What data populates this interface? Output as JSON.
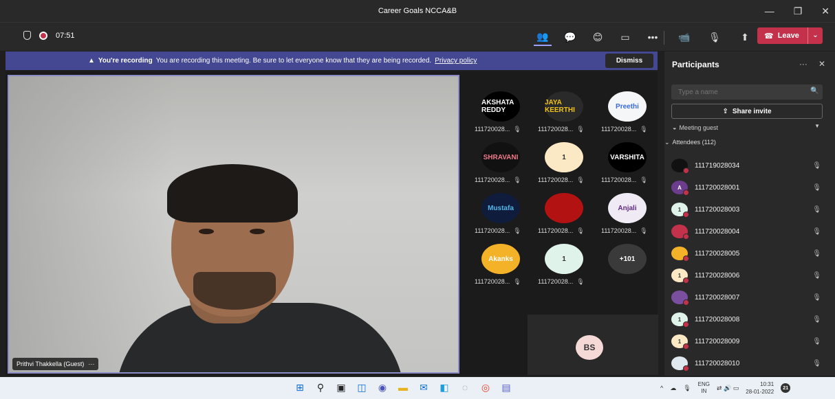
{
  "window": {
    "title": "Career Goals NCCA&B",
    "minimize": "—",
    "maximize": "❐",
    "close": "✕"
  },
  "toolbar": {
    "timer": "07:51",
    "icons": {
      "people": "👥",
      "chat": "💬",
      "reactions": "😊",
      "rooms": "▭",
      "more": "•••",
      "camera": "📹",
      "mic": "🎙",
      "share": "⬆"
    },
    "leave_label": "Leave"
  },
  "banner": {
    "bold": "You're recording",
    "text": "You are recording this meeting. Be sure to let everyone know that they are being recorded.",
    "link": "Privacy policy",
    "dismiss": "Dismiss"
  },
  "main_video": {
    "name": "Prithvi Thakkella (Guest)",
    "more": "···"
  },
  "grid": [
    {
      "avatar": "AKSHATA REDDY",
      "bg": "#000000",
      "fg": "#ffffff",
      "label": "111720028..."
    },
    {
      "avatar": "JAYA KEERTHI",
      "bg": "#2a2a2a",
      "fg": "#f0c419",
      "label": "111720028..."
    },
    {
      "avatar": "Preethi",
      "bg": "#f4f6f8",
      "fg": "#3a6bd8",
      "label": "111720028..."
    },
    {
      "avatar": "SHRAVANI",
      "bg": "#111111",
      "fg": "#f07a8a",
      "label": "111720028..."
    },
    {
      "avatar": "1",
      "bg": "#fbe8c4",
      "fg": "#333333",
      "label": "111720028..."
    },
    {
      "avatar": "VARSHITA",
      "bg": "#000000",
      "fg": "#ffffff",
      "label": "111720028..."
    },
    {
      "avatar": "Mustafa",
      "bg": "#0f1c3b",
      "fg": "#53b6e6",
      "label": "111720028..."
    },
    {
      "avatar": "",
      "bg": "#b31212",
      "fg": "#ffffff",
      "label": "111720028..."
    },
    {
      "avatar": "Anjali",
      "bg": "#f0eaf4",
      "fg": "#5e2d80",
      "label": "111720028..."
    },
    {
      "avatar": "Akanks",
      "bg": "#f3b228",
      "fg": "#ffffff",
      "label": "111720028..."
    },
    {
      "avatar": "1",
      "bg": "#dff3ea",
      "fg": "#333333",
      "label": "111720028..."
    },
    {
      "avatar": "+101",
      "bg": "#3a3a3a",
      "fg": "#ffffff",
      "label": ""
    }
  ],
  "bs_tile": {
    "initials": "BS"
  },
  "panel": {
    "title": "Participants",
    "more": "···",
    "close": "✕",
    "search_placeholder": "Type a name",
    "share_invite": "Share invite",
    "guest_label": "Meeting guest",
    "attendees_header": "Attendees (112)",
    "attendees": [
      {
        "name": "111719028034",
        "bg": "#111111",
        "fg": "#ffffff",
        "pic": ""
      },
      {
        "name": "111720028001",
        "bg": "#6b3d8c",
        "fg": "#ffffff",
        "pic": "A"
      },
      {
        "name": "111720028003",
        "bg": "#dff3ea",
        "fg": "#333333",
        "pic": "1"
      },
      {
        "name": "111720028004",
        "bg": "#c4314b",
        "fg": "#ffffff",
        "pic": ""
      },
      {
        "name": "111720028005",
        "bg": "#f3b228",
        "fg": "#ffffff",
        "pic": ""
      },
      {
        "name": "111720028006",
        "bg": "#fbe8c4",
        "fg": "#333333",
        "pic": "1"
      },
      {
        "name": "111720028007",
        "bg": "#7a4fa0",
        "fg": "#ffffff",
        "pic": ""
      },
      {
        "name": "111720028008",
        "bg": "#dff3ea",
        "fg": "#333333",
        "pic": "1"
      },
      {
        "name": "111720028009",
        "bg": "#fbe8c4",
        "fg": "#333333",
        "pic": "1"
      },
      {
        "name": "111720028010",
        "bg": "#dfe8ef",
        "fg": "#333333",
        "pic": ""
      }
    ]
  },
  "taskbar": {
    "lang": "ENG",
    "region": "IN",
    "time": "10:31",
    "date": "28-01-2022",
    "notif": "21"
  }
}
